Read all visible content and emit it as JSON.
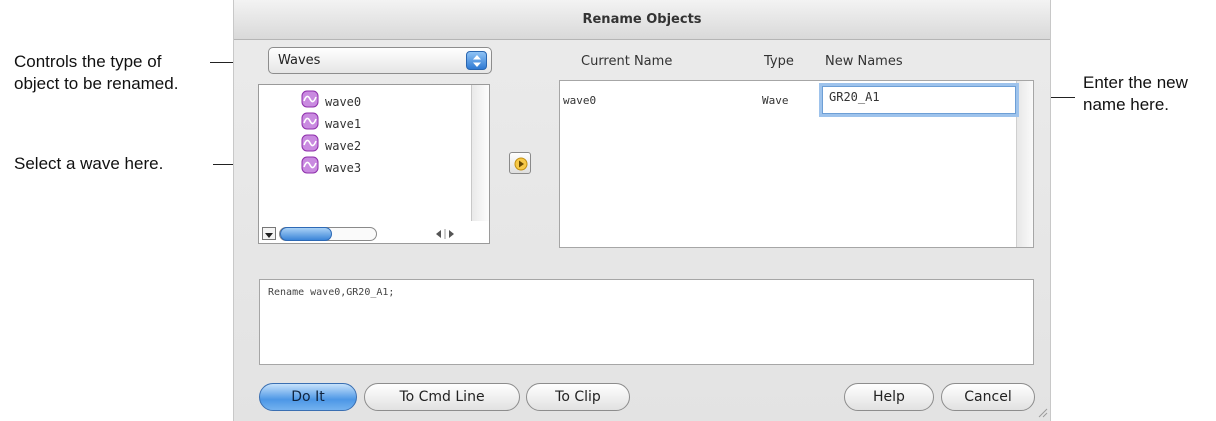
{
  "annotations": {
    "type_control_line1": "Controls the type of",
    "type_control_line2": "object to be renamed.",
    "select_wave": "Select a wave here.",
    "enter_name_line1": "Enter the new",
    "enter_name_line2": "name here."
  },
  "dialog": {
    "title": "Rename Objects",
    "object_type_popup": {
      "selected": "Waves"
    },
    "wave_list": {
      "items": [
        "wave0",
        "wave1",
        "wave2",
        "wave3"
      ]
    },
    "table": {
      "headers": {
        "current_name": "Current Name",
        "type": "Type",
        "new_names": "New Names"
      },
      "rows": [
        {
          "current_name": "wave0",
          "type": "Wave",
          "new_name": "GR20_A1"
        }
      ]
    },
    "command_text": "Rename wave0,GR20_A1;",
    "buttons": {
      "do_it": "Do It",
      "to_cmd_line": "To Cmd Line",
      "to_clip": "To Clip",
      "help": "Help",
      "cancel": "Cancel"
    }
  },
  "colors": {
    "default_button": "#4c97e6",
    "focus_ring": "#9ec3ec",
    "wave_icon": "#9b3fb5"
  },
  "icons": {
    "popup": "up-down-arrows-icon",
    "wave": "wave-icon",
    "transfer": "right-arrow-icon"
  }
}
